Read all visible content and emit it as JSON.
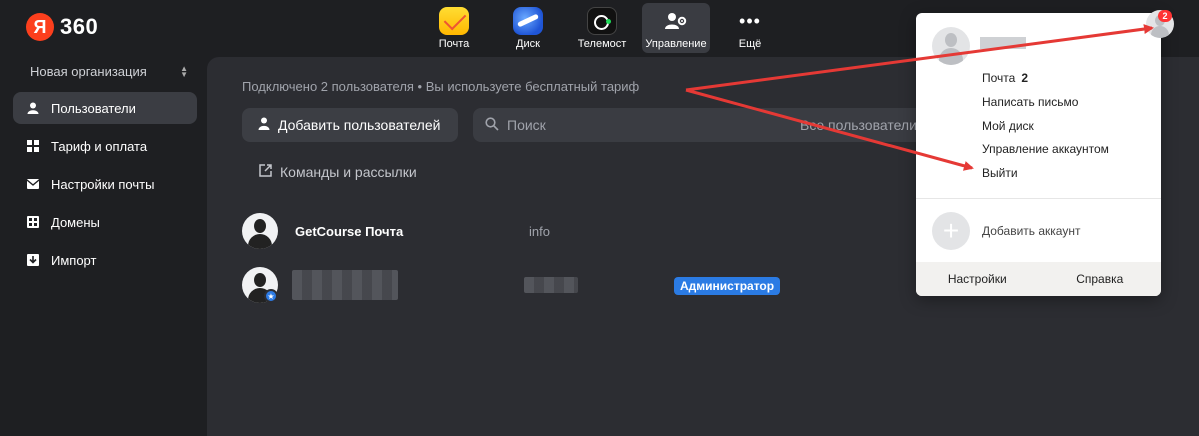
{
  "brand": {
    "mark": "Я",
    "name": "360"
  },
  "topnav": [
    {
      "label": "Почта",
      "icon": "mail-icon"
    },
    {
      "label": "Диск",
      "icon": "disk-icon"
    },
    {
      "label": "Телемост",
      "icon": "telemost-icon"
    },
    {
      "label": "Управление",
      "icon": "manage-icon",
      "active": true
    },
    {
      "label": "Ещё",
      "icon": "more-icon"
    }
  ],
  "sidebar": {
    "org_name": "Новая организация",
    "items": [
      {
        "label": "Пользователи",
        "icon": "user-icon",
        "active": true
      },
      {
        "label": "Тариф и оплата",
        "icon": "grid-icon"
      },
      {
        "label": "Настройки почты",
        "icon": "envelope-icon"
      },
      {
        "label": "Домены",
        "icon": "domain-icon"
      },
      {
        "label": "Импорт",
        "icon": "import-icon"
      }
    ]
  },
  "main": {
    "info": "Подключено 2 пользователя • Вы используете бесплатный тариф",
    "add_button": "Добавить пользователей",
    "search_placeholder": "Поиск",
    "filter_label": "Все пользователи",
    "teams_link": "Команды и рассылки",
    "users": [
      {
        "name": "GetCourse Почта",
        "login": "info",
        "role": ""
      },
      {
        "name": "",
        "login": "",
        "role": "Администратор"
      }
    ]
  },
  "account_menu": {
    "mail_label": "Почта",
    "mail_count": "2",
    "write": "Написать письмо",
    "disk": "Мой диск",
    "manage_account": "Управление аккаунтом",
    "logout": "Выйти",
    "add_account": "Добавить аккаунт",
    "settings": "Настройки",
    "help": "Справка"
  },
  "profile": {
    "badge": "2"
  },
  "colors": {
    "accent": "#2b7be4",
    "brand": "#fc3f1d",
    "annotation": "#e53935"
  }
}
